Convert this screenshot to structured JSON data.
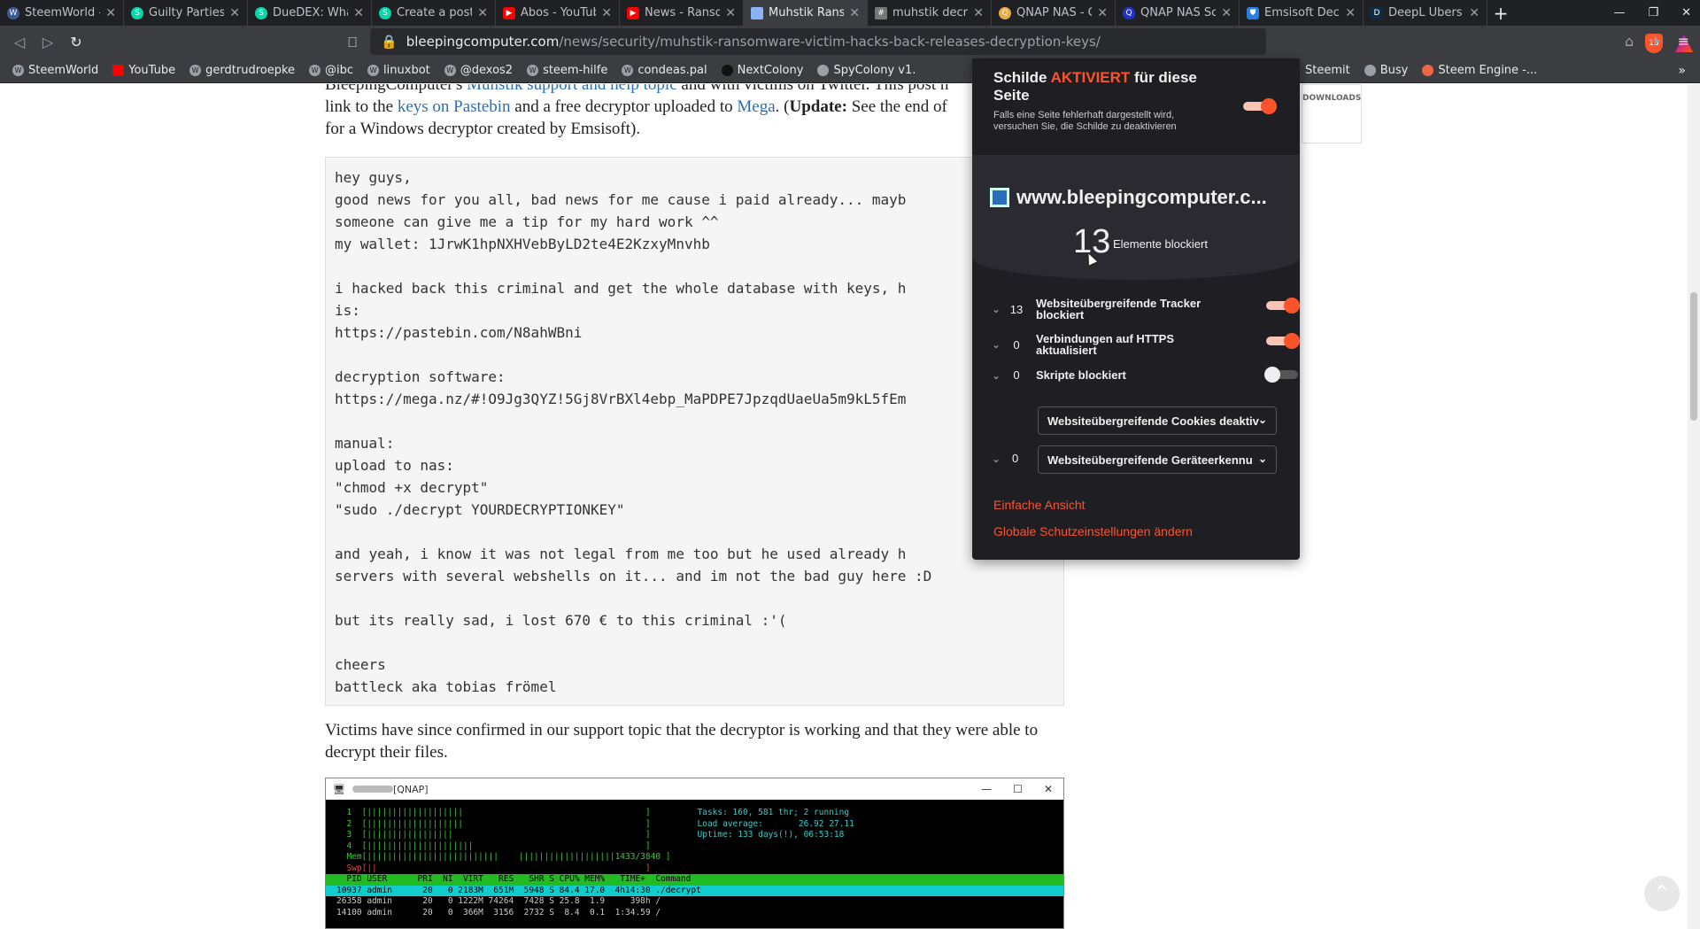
{
  "tabs": [
    {
      "title": "SteemWorld - S",
      "icon": "steem-icon",
      "active": false
    },
    {
      "title": "Guilty Parties",
      "icon": "steemit-icon",
      "active": false
    },
    {
      "title": "DueDEX: Wha",
      "icon": "steemit-icon",
      "active": false
    },
    {
      "title": "Create a post",
      "icon": "steemit-icon",
      "active": false
    },
    {
      "title": "Abos - YouTub",
      "icon": "youtube-icon",
      "active": false
    },
    {
      "title": "News - Ranso",
      "icon": "youtube-icon",
      "active": false
    },
    {
      "title": "Muhstik Rans",
      "icon": "bleepingcomputer-icon",
      "active": true
    },
    {
      "title": "muhstik decr",
      "icon": "wikihow-icon",
      "active": false
    },
    {
      "title": "QNAP NAS - C",
      "icon": "search-icon",
      "active": false
    },
    {
      "title": "QNAP NAS Sc",
      "icon": "qnap-icon",
      "active": false
    },
    {
      "title": "Emsisoft Dec",
      "icon": "shield-icon",
      "active": false
    },
    {
      "title": "DeepL Übers",
      "icon": "deepl-icon",
      "active": false
    }
  ],
  "url": {
    "host": "bleepingcomputer.com",
    "path": "/news/security/muhstik-ransomware-victim-hacks-back-releases-decryption-keys/"
  },
  "shield_badge": "13",
  "bookmarks": [
    {
      "label": "SteemWorld",
      "icon": "steem-icon"
    },
    {
      "label": "YouTube",
      "icon": "youtube-icon"
    },
    {
      "label": "gerdtrudroepke",
      "icon": "steem-icon"
    },
    {
      "label": "@ibc",
      "icon": "steem-icon"
    },
    {
      "label": "linuxbot",
      "icon": "steem-icon"
    },
    {
      "label": "@dexos2",
      "icon": "steem-icon"
    },
    {
      "label": "steem-hilfe",
      "icon": "steem-icon"
    },
    {
      "label": "condeas.pal",
      "icon": "steem-icon"
    },
    {
      "label": "NextColony",
      "icon": "nextcolony-icon"
    },
    {
      "label": "SpyColony v1.",
      "icon": "spycolony-icon"
    }
  ],
  "bookmarks_right": [
    {
      "label": "Steemit",
      "icon": "steem-icon"
    },
    {
      "label": "Busy",
      "icon": "busy-icon"
    },
    {
      "label": "Steem Engine -...",
      "icon": "steem-engine-icon"
    }
  ],
  "article": {
    "intro_1": "BleepingComputer's ",
    "intro_link1": "Muhstik support and help topic",
    "intro_2": " and with victims on Twitter. This post h",
    "intro_3": "link to the ",
    "intro_link2": "keys on Pastebin",
    "intro_4": " and a free decryptor uploaded to ",
    "intro_link3": "Mega",
    "intro_5": ". (",
    "intro_update": "Update:",
    "intro_6": " See the end of",
    "intro_7": "for a Windows decryptor created by Emsisoft).",
    "code": "hey guys,\ngood news for you all, bad news for me cause i paid already... mayb\nsomeone can give me a tip for my hard work ^^\nmy wallet: 1JrwK1hpNXHVebByLD2te4E2KzxyMnvhb\n\ni hacked back this criminal and get the whole database with keys, h\nis:\nhttps://pastebin.com/N8ahWBni\n\ndecryption software:\nhttps://mega.nz/#!O9Jg3QYZ!5Gj8VrBXl4ebp_MaPDPE7JpzqdUaeUa5m9kL5fEm\n\nmanual:\nupload to nas:\n\"chmod +x decrypt\"\n\"sudo ./decrypt YOURDECRYPTIONKEY\"\n\nand yeah, i know it was not legal from me too but he used already h\nservers with several webshells on it... and im not the bad guy here :D\n\nbut its really sad, i lost 670 € to this criminal :'(\n\ncheers\nbattleck aka tobias frömel",
    "after": "Victims have since confirmed in our support topic that the decryptor is working and that they were able to decrypt their files.",
    "shot_title": "[QNAP]",
    "downloads": "DOWNLOADS"
  },
  "term": {
    "cpu1": "  1  [|||||||||||||||||||                                    ]",
    "cpu2": "  2  [|||||||||||||||||||                                    ]",
    "cpu3": "  3  [|||||||||||||||||                                      ]",
    "cpu4": "  4  [|||||||||||||||||||||                                  ]",
    "mem": "  Mem[||||||||||||||||||||||||||    |||||||||||||||||||1433/3840 ]",
    "swp": "  Swp[||                                                     ]",
    "tasks": "Tasks: 160, 581 thr; 2 running",
    "load": "Load average:       26.92 27.11",
    "uptime": "Uptime: 133 days(!), 06:53:18",
    "header": "  PID USER      PRI  NI  VIRT   RES   SHR S CPU% MEM%   TIME+  Command",
    "row1": "10937 admin      20   0 2183M  651M  5948 S 84.4 17.0  4h14:30 ./decrypt",
    "row2": "26358 admin      20   0 1222M 74264  7428 S 25.8  1.9     398h /",
    "row3": "14100 admin      20   0  366M  3156  2732 S  8.4  0.1  1:34.59 /"
  },
  "panel": {
    "title_1": "Schilde ",
    "title_on": "AKTIVIERT",
    "title_2": " für diese Seite",
    "subtitle": "Falls eine Seite fehlerhaft dargestellt wird, versuchen Sie, die Schilde zu deaktivieren",
    "site": "www.bleepingcomputer.c...",
    "count": "13",
    "count_label": "Elemente blockiert",
    "rows": [
      {
        "n": "13",
        "label": "Websiteübergreifende Tracker blockiert",
        "state": "on"
      },
      {
        "n": "0",
        "label": "Verbindungen auf HTTPS aktualisiert",
        "state": "on"
      },
      {
        "n": "0",
        "label": "Skripte blockiert",
        "state": "off"
      }
    ],
    "cookies_select": "Websiteübergreifende Cookies deaktiv",
    "fp_n": "0",
    "fingerprint_select": "Websiteübergreifende Geräteerkennu",
    "link_simple": "Einfache Ansicht",
    "link_global": "Globale Schutzeinstellungen ändern"
  },
  "colors": {
    "brave_orange": "#fb542b",
    "link": "#2a6ebb",
    "panel_bg": "#1f1f23"
  }
}
